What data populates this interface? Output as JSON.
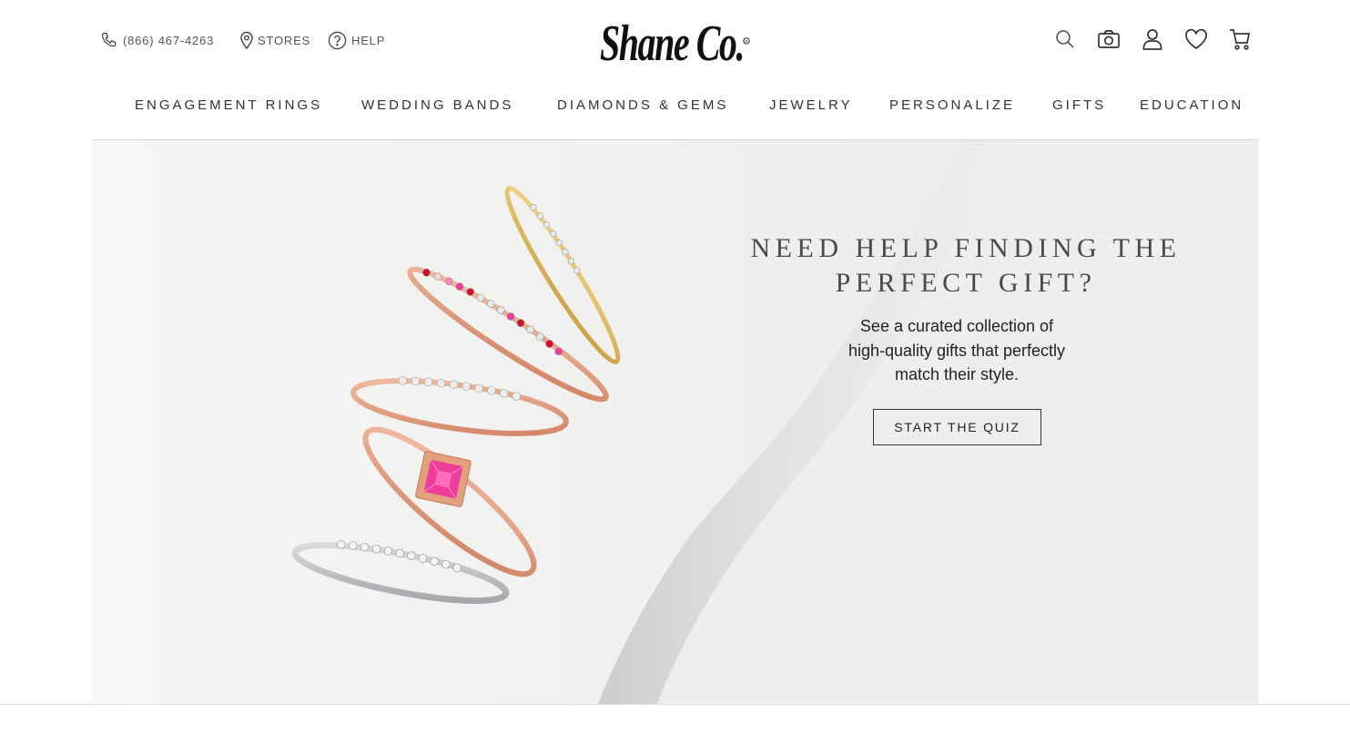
{
  "header": {
    "phone": "(866) 467-4263",
    "stores": "STORES",
    "help": "HELP",
    "logo_text": "Shane Co.",
    "icons": [
      "search-icon",
      "camera-icon",
      "account-icon",
      "heart-icon",
      "cart-icon"
    ]
  },
  "nav": {
    "items": [
      "ENGAGEMENT RINGS",
      "WEDDING BANDS",
      "DIAMONDS & GEMS",
      "JEWELRY",
      "PERSONALIZE",
      "GIFTS",
      "EDUCATION"
    ]
  },
  "hero": {
    "title_line1": "NEED HELP FINDING THE",
    "title_line2": "PERFECT GIFT?",
    "sub_line1": "See a curated collection of",
    "sub_line2": "high-quality gifts that perfectly",
    "sub_line3": "match their style.",
    "cta": "START THE QUIZ"
  },
  "colors": {
    "text": "#333333",
    "ring_gold": "#d9b45a",
    "ring_rose": "#d9967a",
    "ring_silver": "#b8b8bc",
    "gem_pink": "#ee3c9a",
    "gem_red": "#d01030"
  }
}
